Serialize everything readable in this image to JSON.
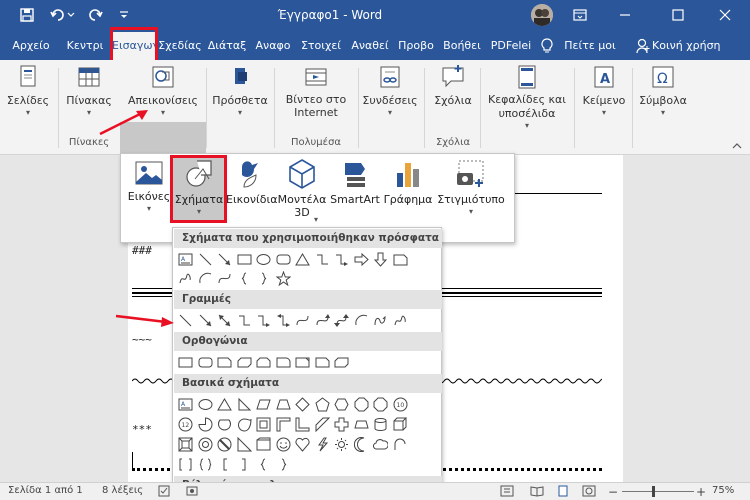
{
  "window": {
    "title": "Έγγραφο1 - Word"
  },
  "tabs": [
    "Αρχείο",
    "Κεντρι",
    "Εισαγωγ",
    "Σχεδίας",
    "Διάταξ",
    "Αναφο",
    "Στοιχεί",
    "Αναθεί",
    "Προβο",
    "Βοήθει",
    "PDFelei",
    "Πείτε μοι",
    "Κοινή χρήση"
  ],
  "ribbon": {
    "pages": "Σελίδες",
    "table": "Πίνακας",
    "illustrations": "Απεικονίσεις",
    "addins": "Πρόσθετα",
    "video": "Βίντεο στο Internet",
    "links": "Συνδέσεις",
    "comment": "Σχόλια",
    "header_footer": "Κεφαλίδες και υποσέλιδα",
    "text": "Κείμενο",
    "symbols": "Σύμβολα",
    "group_tables": "Πίνακες",
    "group_media": "Πολυμέσα",
    "group_comments": "Σχόλια"
  },
  "gallery": {
    "pictures": "Εικόνες",
    "shapes": "Σχήματα",
    "icons": "Εικονίδια",
    "models": "Μοντέλα 3D",
    "smartart": "SmartArt",
    "chart": "Γράφημα",
    "screenshot": "Στιγμιότυπο"
  },
  "shapes_menu": {
    "recent": "Σχήματα που χρησιμοποιήθηκαν πρόσφατα",
    "lines": "Γραμμές",
    "rect": "Ορθογώνια",
    "basic": "Βασικά σχήματα",
    "block": "Βέλη τύπου μπλοκ"
  },
  "document": {
    "line1": "###",
    "line2": "~~~",
    "line3": "***"
  },
  "status": {
    "page": "Σελίδα 1 από 1",
    "words": "8 λέξεις",
    "zoom": "75%",
    "minus": "−",
    "plus": "+"
  },
  "colors": {
    "accent": "#2b579a",
    "highlight": "#e81123"
  }
}
